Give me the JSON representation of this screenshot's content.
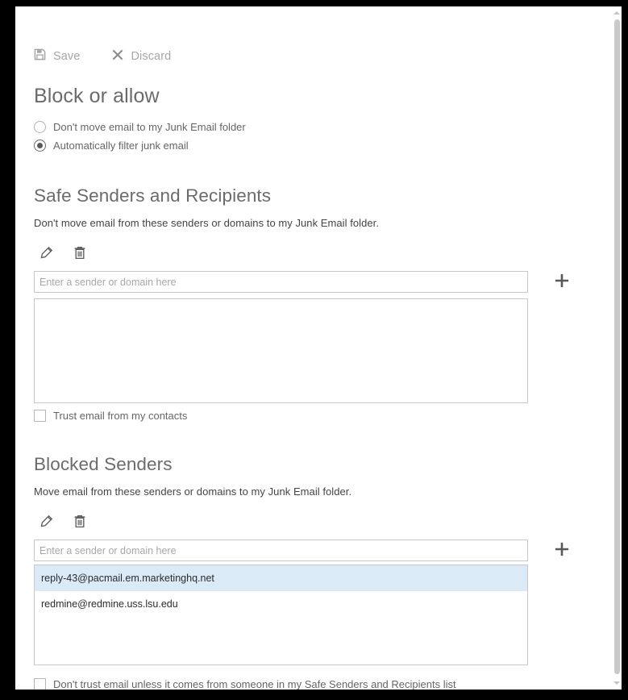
{
  "toolbar": {
    "save_label": "Save",
    "save_icon": "save-floppy-icon",
    "discard_label": "Discard",
    "discard_icon": "close-x-icon"
  },
  "page_title": "Block or allow",
  "junk_options": {
    "items": [
      {
        "label": "Don't move email to my Junk Email folder",
        "selected": false
      },
      {
        "label": "Automatically filter junk email",
        "selected": true
      }
    ]
  },
  "safe_senders": {
    "title": "Safe Senders and Recipients",
    "description": "Don't move email from these senders or domains to my Junk Email folder.",
    "edit_icon": "pencil-edit-icon",
    "delete_icon": "trash-delete-icon",
    "add_icon": "plus-add-icon",
    "input_placeholder": "Enter a sender or domain here",
    "input_value": "",
    "items": [],
    "checkbox_label": "Trust email from my contacts",
    "checkbox_checked": false
  },
  "blocked_senders": {
    "title": "Blocked Senders",
    "description": "Move email from these senders or domains to my Junk Email folder.",
    "edit_icon": "pencil-edit-icon",
    "delete_icon": "trash-delete-icon",
    "add_icon": "plus-add-icon",
    "input_placeholder": "Enter a sender or domain here",
    "input_value": "",
    "items": [
      {
        "address": "reply-43@pacmail.em.marketinghq.net",
        "selected": true
      },
      {
        "address": "redmine@redmine.uss.lsu.edu",
        "selected": false
      }
    ],
    "checkbox_label": "Don't trust email unless it comes from someone in my Safe Senders and Recipients list",
    "checkbox_checked": false
  },
  "colors": {
    "selection_blue": "#dbeaf7",
    "heading_gray": "#6b6b6b",
    "border_gray": "#c8c8c8",
    "icon_gray": "#5a5a5a"
  },
  "scrollbar": {
    "up_arrow_icon": "chevron-up-icon",
    "down_arrow_icon": "chevron-down-icon"
  }
}
